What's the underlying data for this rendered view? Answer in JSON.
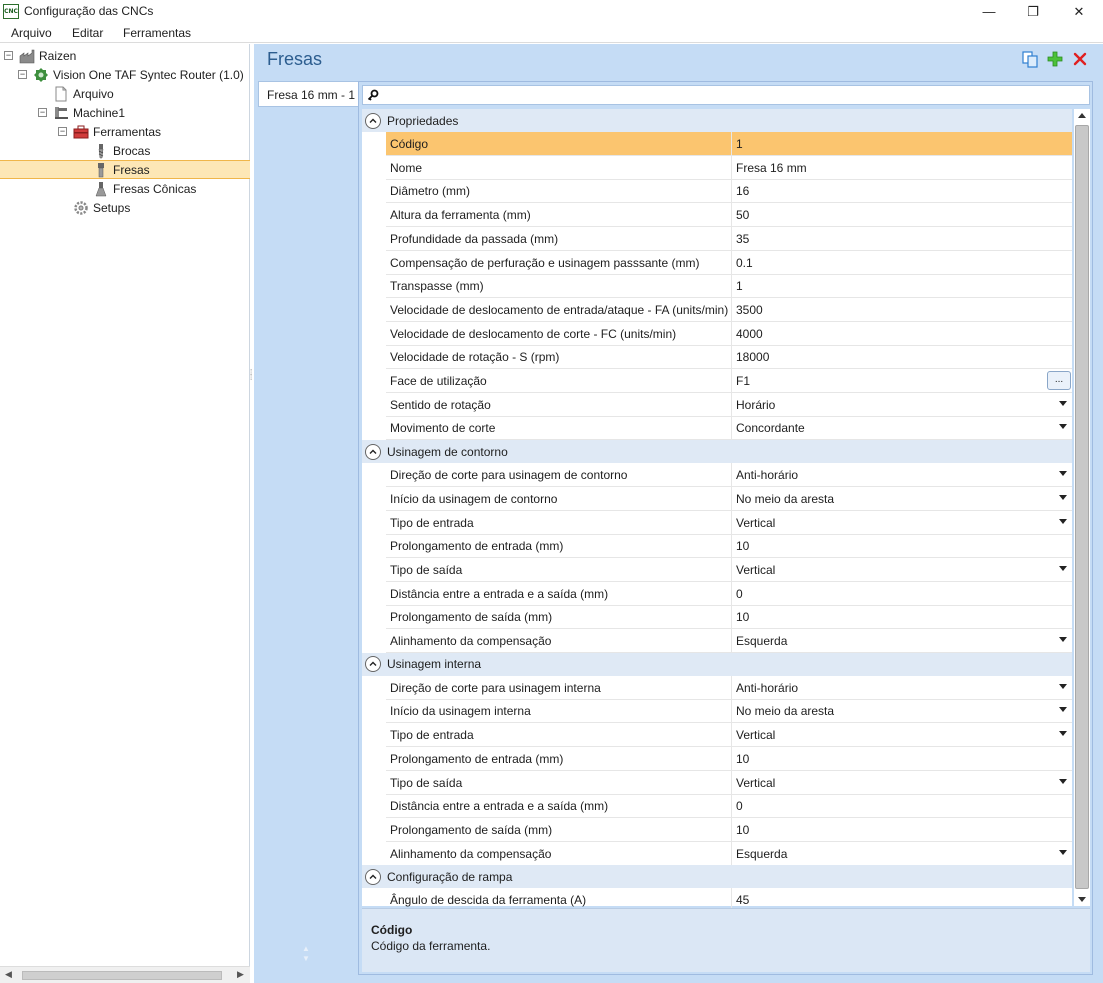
{
  "window": {
    "title": "Configuração das CNCs",
    "app_icon_text": "CNC",
    "minimize": "—",
    "maximize": "❐",
    "close": "✕"
  },
  "menu": [
    "Arquivo",
    "Editar",
    "Ferramentas"
  ],
  "tree": {
    "items": [
      {
        "label": "Raizen",
        "level": 0,
        "expander": "⊟",
        "icon": "factory-icon"
      },
      {
        "label": "Vision One TAF Syntec Router (1.0)",
        "level": 1,
        "expander": "⊟",
        "icon": "machine-gear-icon"
      },
      {
        "label": "Arquivo",
        "level": 2,
        "expander": "",
        "icon": "file-icon"
      },
      {
        "label": "Machine1",
        "level": 2,
        "expander": "⊟",
        "icon": "cnc-machine-icon"
      },
      {
        "label": "Ferramentas",
        "level": 3,
        "expander": "⊟",
        "icon": "toolbox-icon"
      },
      {
        "label": "Brocas",
        "level": 4,
        "expander": "",
        "icon": "drill-bit-icon"
      },
      {
        "label": "Fresas",
        "level": 4,
        "expander": "",
        "icon": "mill-bit-icon",
        "selected": true
      },
      {
        "label": "Fresas Cônicas",
        "level": 4,
        "expander": "",
        "icon": "conical-bit-icon"
      },
      {
        "label": "Setups",
        "level": 3,
        "expander": "",
        "icon": "gear-icon"
      }
    ]
  },
  "panel": {
    "title": "Fresas",
    "tab_label": "Fresa 16 mm - 1"
  },
  "toolbar": {
    "copy_icon": "copy-icon",
    "add_icon": "add-icon",
    "delete_icon": "delete-icon"
  },
  "colors": {
    "selection": "#fbc56f",
    "panel_bg": "#c5dcf5",
    "title_blue": "#2c5d8f",
    "add_green": "#3cb531",
    "delete_red": "#e02020"
  },
  "categories": [
    {
      "name": "Propriedades",
      "props": [
        {
          "name": "Código",
          "value": "1",
          "editor": "text",
          "selected": true
        },
        {
          "name": "Nome",
          "value": "Fresa 16 mm",
          "editor": "text"
        },
        {
          "name": "Diâmetro (mm)",
          "value": "16",
          "editor": "text"
        },
        {
          "name": "Altura da ferramenta (mm)",
          "value": "50",
          "editor": "text"
        },
        {
          "name": "Profundidade da passada (mm)",
          "value": "35",
          "editor": "text"
        },
        {
          "name": "Compensação de perfuração e usinagem passsante (mm)",
          "value": "0.1",
          "editor": "text"
        },
        {
          "name": "Transpasse (mm)",
          "value": "1",
          "editor": "text"
        },
        {
          "name": "Velocidade de deslocamento de entrada/ataque - FA (units/min)",
          "value": "3500",
          "editor": "text"
        },
        {
          "name": "Velocidade de deslocamento de corte - FC (units/min)",
          "value": "4000",
          "editor": "text"
        },
        {
          "name": "Velocidade de rotação - S (rpm)",
          "value": "18000",
          "editor": "text"
        },
        {
          "name": "Face de utilização",
          "value": "F1",
          "editor": "ellipsis",
          "button": "..."
        },
        {
          "name": "Sentido de rotação",
          "value": "Horário",
          "editor": "dropdown"
        },
        {
          "name": "Movimento de corte",
          "value": "Concordante",
          "editor": "dropdown"
        }
      ]
    },
    {
      "name": "Usinagem de contorno",
      "props": [
        {
          "name": "Direção de corte para usinagem de contorno",
          "value": "Anti-horário",
          "editor": "dropdown"
        },
        {
          "name": "Início da usinagem de contorno",
          "value": "No meio da aresta",
          "editor": "dropdown"
        },
        {
          "name": "Tipo de entrada",
          "value": "Vertical",
          "editor": "dropdown"
        },
        {
          "name": "Prolongamento de entrada (mm)",
          "value": "10",
          "editor": "text"
        },
        {
          "name": "Tipo de saída",
          "value": "Vertical",
          "editor": "dropdown"
        },
        {
          "name": "Distância entre a entrada e a saída (mm)",
          "value": "0",
          "editor": "text"
        },
        {
          "name": "Prolongamento de saída (mm)",
          "value": "10",
          "editor": "text"
        },
        {
          "name": "Alinhamento da compensação",
          "value": "Esquerda",
          "editor": "dropdown"
        }
      ]
    },
    {
      "name": "Usinagem interna",
      "props": [
        {
          "name": "Direção de corte para usinagem interna",
          "value": "Anti-horário",
          "editor": "dropdown"
        },
        {
          "name": "Início da usinagem interna",
          "value": "No meio da aresta",
          "editor": "dropdown"
        },
        {
          "name": "Tipo de entrada",
          "value": "Vertical",
          "editor": "dropdown"
        },
        {
          "name": "Prolongamento de entrada (mm)",
          "value": "10",
          "editor": "text"
        },
        {
          "name": "Tipo de saída",
          "value": "Vertical",
          "editor": "dropdown"
        },
        {
          "name": "Distância entre a entrada e a saída (mm)",
          "value": "0",
          "editor": "text"
        },
        {
          "name": "Prolongamento de saída (mm)",
          "value": "10",
          "editor": "text"
        },
        {
          "name": "Alinhamento da compensação",
          "value": "Esquerda",
          "editor": "dropdown"
        }
      ]
    },
    {
      "name": "Configuração de rampa",
      "props": [
        {
          "name": "Ângulo de descida da ferramenta (A)",
          "value": "45",
          "editor": "text"
        }
      ]
    }
  ],
  "description": {
    "title": "Código",
    "text": "Código da ferramenta."
  }
}
